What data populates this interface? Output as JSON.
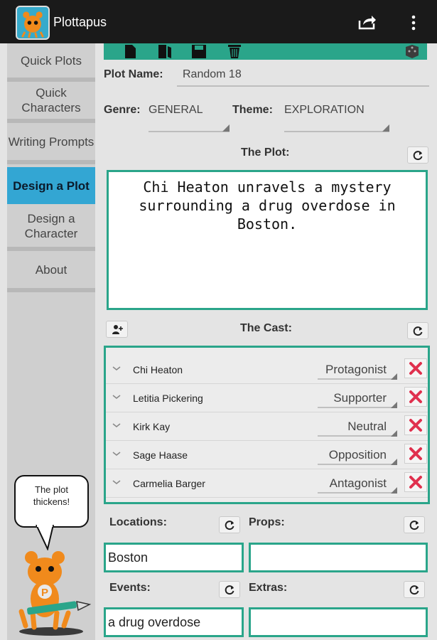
{
  "app": {
    "title": "Plottapus"
  },
  "icons": {
    "app": "octopus-mascot-icon",
    "share": "share-icon",
    "overflow": "overflow-menu-icon",
    "toolbar": [
      "new-file-icon",
      "open-book-icon",
      "save-icon",
      "trash-icon",
      "dice-icon"
    ],
    "refresh": "refresh-icon",
    "delete": "delete-x-icon",
    "add_cast": "add-person-icon"
  },
  "colors": {
    "accent": "#2aa58a",
    "nav_active": "#33a6d3",
    "delete": "#e0304e",
    "mascot": "#f08a1c",
    "actionbar": "#1a1a1a"
  },
  "sidebar": {
    "items": [
      {
        "label": "Quick Plots",
        "active": false
      },
      {
        "label": "Quick Characters",
        "active": false
      },
      {
        "label": "Writing Prompts",
        "active": false
      },
      {
        "label": "Design a Plot",
        "active": true
      },
      {
        "label": "Design a Character",
        "active": false
      },
      {
        "label": "About",
        "active": false
      }
    ],
    "bubble_text": "The plot thickens!"
  },
  "plot": {
    "name_label": "Plot Name:",
    "name_value": "Random 18",
    "genre_label": "Genre:",
    "genre_value": "GENERAL",
    "theme_label": "Theme:",
    "theme_value": "EXPLORATION",
    "plot_label": "The Plot:",
    "plot_text": "Chi Heaton unravels a mystery surrounding a drug overdose in Boston."
  },
  "cast": {
    "label": "The Cast:",
    "members": [
      {
        "name": "Chi Heaton",
        "role": "Protagonist"
      },
      {
        "name": "Letitia Pickering",
        "role": "Supporter"
      },
      {
        "name": "Kirk Kay",
        "role": "Neutral"
      },
      {
        "name": "Sage Haase",
        "role": "Opposition"
      },
      {
        "name": "Carmelia Barger",
        "role": "Antagonist"
      }
    ]
  },
  "fields": {
    "locations_label": "Locations:",
    "locations_value": "Boston",
    "props_label": "Props:",
    "props_value": "",
    "events_label": "Events:",
    "events_value": "a drug overdose",
    "extras_label": "Extras:",
    "extras_value": ""
  }
}
